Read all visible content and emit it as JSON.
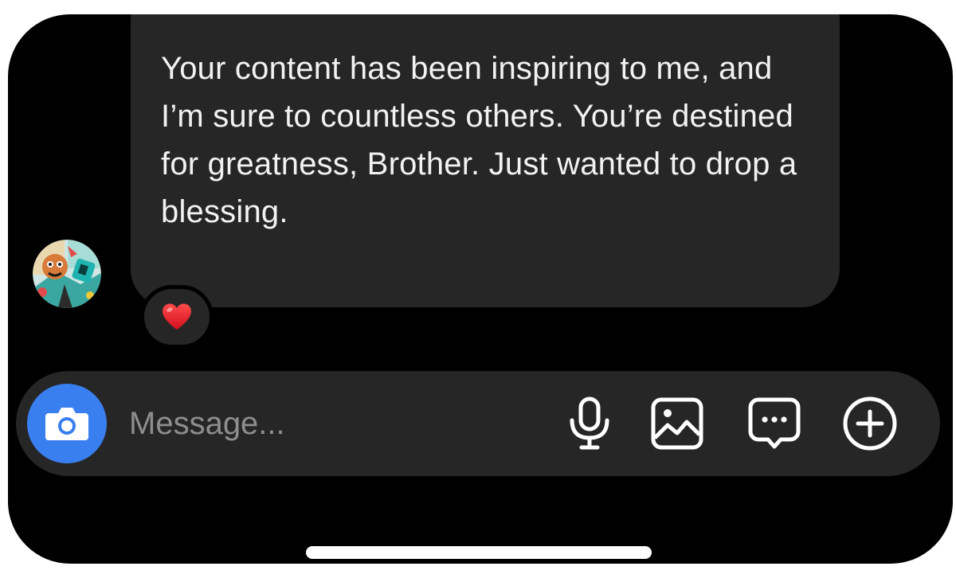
{
  "thread": {
    "message": {
      "text": "Your content has been inspiring to me, and I’m sure to countless others. You’re destined for greatness, Brother. Just wanted to drop a blessing.",
      "reaction": "❤️"
    }
  },
  "composer": {
    "placeholder": "Message..."
  },
  "icons": {
    "camera": "camera-icon",
    "microphone": "microphone-icon",
    "gallery": "image-icon",
    "sticker": "chat-bubble-icon",
    "more": "plus-circle-icon"
  },
  "colors": {
    "background": "#000000",
    "bubble": "#262626",
    "accent": "#3a7ff0",
    "text": "#f2f2f2",
    "placeholder": "#8e8e8e"
  }
}
